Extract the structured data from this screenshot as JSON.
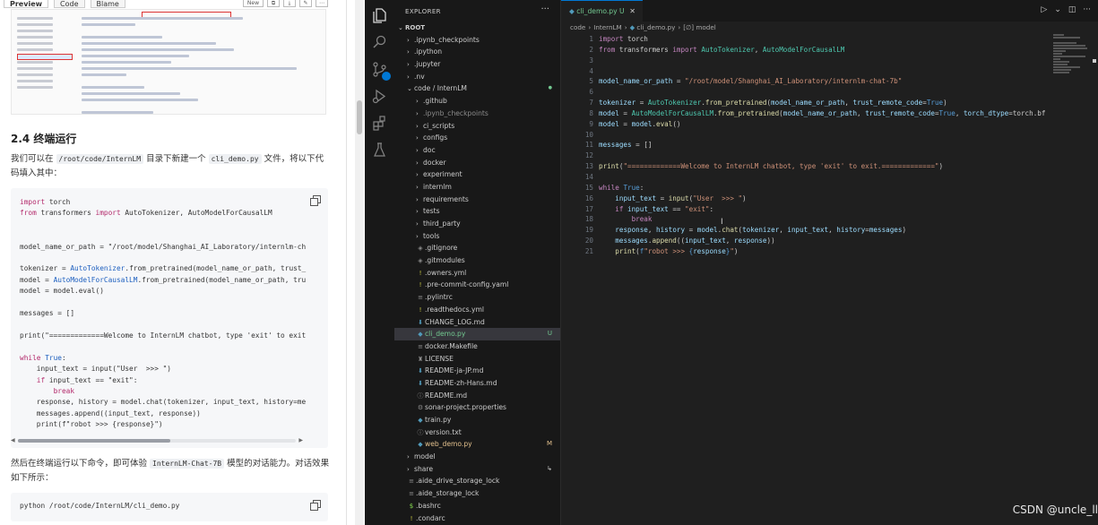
{
  "doc": {
    "tabs": [
      "Preview",
      "Code",
      "Blame"
    ],
    "tool_new": "New",
    "section_title": "2.4 终端运行",
    "para1": [
      "我们可以在 ",
      "/root/code/InternLM",
      " 目录下新建一个 ",
      "cli_demo.py",
      " 文件，将以下代码填入其中："
    ],
    "code_lines": [
      "import torch",
      "from transformers import AutoTokenizer, AutoModelForCausalLM",
      "",
      "",
      "model_name_or_path = \"/root/model/Shanghai_AI_Laboratory/internlm-ch",
      "",
      "tokenizer = AutoTokenizer.from_pretrained(model_name_or_path, trust_",
      "model = AutoModelForCausalLM.from_pretrained(model_name_or_path, tru",
      "model = model.eval()",
      "",
      "messages = []",
      "",
      "print(\"=============Welcome to InternLM chatbot, type 'exit' to exit",
      "",
      "while True:",
      "    input_text = input(\"User  >>> \")",
      "    if input_text == \"exit\":",
      "        break",
      "    response, history = model.chat(tokenizer, input_text, history=me",
      "    messages.append((input_text, response))",
      "    print(f\"robot >>> {response}\")"
    ],
    "para2": [
      "然后在终端运行以下命令，即可体验 ",
      "InternLM-Chat-7B",
      " 模型的对话能力。对话效果如下所示："
    ],
    "command": "python /root/code/InternLM/cli_demo.py"
  },
  "explorer": {
    "title": "EXPLORER",
    "more": "···",
    "items": [
      {
        "label": "ROOT",
        "depth": 0,
        "kind": "root-open"
      },
      {
        "label": ".ipynb_checkpoints",
        "depth": 1,
        "kind": "folder"
      },
      {
        "label": ".ipython",
        "depth": 1,
        "kind": "folder"
      },
      {
        "label": ".jupyter",
        "depth": 1,
        "kind": "folder"
      },
      {
        "label": ".nv",
        "depth": 1,
        "kind": "folder"
      },
      {
        "label": "code / InternLM",
        "depth": 1,
        "kind": "folder-open",
        "status": "dot"
      },
      {
        "label": ".github",
        "depth": 2,
        "kind": "folder"
      },
      {
        "label": ".ipynb_checkpoints",
        "depth": 2,
        "kind": "folder",
        "dim": true
      },
      {
        "label": "ci_scripts",
        "depth": 2,
        "kind": "folder"
      },
      {
        "label": "configs",
        "depth": 2,
        "kind": "folder"
      },
      {
        "label": "doc",
        "depth": 2,
        "kind": "folder"
      },
      {
        "label": "docker",
        "depth": 2,
        "kind": "folder"
      },
      {
        "label": "experiment",
        "depth": 2,
        "kind": "folder"
      },
      {
        "label": "internlm",
        "depth": 2,
        "kind": "folder"
      },
      {
        "label": "requirements",
        "depth": 2,
        "kind": "folder"
      },
      {
        "label": "tests",
        "depth": 2,
        "kind": "folder"
      },
      {
        "label": "third_party",
        "depth": 2,
        "kind": "folder"
      },
      {
        "label": "tools",
        "depth": 2,
        "kind": "folder"
      },
      {
        "label": ".gitignore",
        "depth": 2,
        "kind": "file",
        "icon": "◈"
      },
      {
        "label": ".gitmodules",
        "depth": 2,
        "kind": "file",
        "icon": "◈"
      },
      {
        "label": ".owners.yml",
        "depth": 2,
        "kind": "file",
        "icon": "!"
      },
      {
        "label": ".pre-commit-config.yaml",
        "depth": 2,
        "kind": "file",
        "icon": "!"
      },
      {
        "label": ".pylintrc",
        "depth": 2,
        "kind": "file",
        "icon": "≡"
      },
      {
        "label": ".readthedocs.yml",
        "depth": 2,
        "kind": "file",
        "icon": "!"
      },
      {
        "label": "CHANGE_LOG.md",
        "depth": 2,
        "kind": "file",
        "icon": "⬇"
      },
      {
        "label": "cli_demo.py",
        "depth": 2,
        "kind": "file",
        "icon": "◆",
        "status": "U",
        "selected": true
      },
      {
        "label": "docker.Makefile",
        "depth": 2,
        "kind": "file",
        "icon": "≡"
      },
      {
        "label": "LICENSE",
        "depth": 2,
        "kind": "file",
        "icon": "♜"
      },
      {
        "label": "README-ja-JP.md",
        "depth": 2,
        "kind": "file",
        "icon": "⬇"
      },
      {
        "label": "README-zh-Hans.md",
        "depth": 2,
        "kind": "file",
        "icon": "⬇"
      },
      {
        "label": "README.md",
        "depth": 2,
        "kind": "file",
        "icon": "ⓘ"
      },
      {
        "label": "sonar-project.properties",
        "depth": 2,
        "kind": "file",
        "icon": "⚙"
      },
      {
        "label": "train.py",
        "depth": 2,
        "kind": "file",
        "icon": "◆"
      },
      {
        "label": "version.txt",
        "depth": 2,
        "kind": "file",
        "icon": "ⓘ"
      },
      {
        "label": "web_demo.py",
        "depth": 2,
        "kind": "file",
        "icon": "◆",
        "status": "M"
      },
      {
        "label": "model",
        "depth": 1,
        "kind": "folder"
      },
      {
        "label": "share",
        "depth": 1,
        "kind": "folder",
        "status": "↳"
      },
      {
        "label": ".aide_drive_storage_lock",
        "depth": 1,
        "kind": "file",
        "icon": "≡"
      },
      {
        "label": ".aide_storage_lock",
        "depth": 1,
        "kind": "file",
        "icon": "≡"
      },
      {
        "label": ".bashrc",
        "depth": 1,
        "kind": "file",
        "icon": "$"
      },
      {
        "label": ".condarc",
        "depth": 1,
        "kind": "file",
        "icon": "!"
      }
    ]
  },
  "editor": {
    "tab_label": "cli_demo.py U",
    "tab_close": "✕",
    "breadcrumbs": [
      "code",
      "InternLM",
      "cli_demo.py",
      "[∅] model"
    ],
    "line_numbers": [
      "1",
      "2",
      "3",
      "4",
      "5",
      "6",
      "7",
      "8",
      "9",
      "10",
      "11",
      "12",
      "13",
      "14",
      "15",
      "16",
      "17",
      "18",
      "19",
      "20",
      "21"
    ]
  },
  "colors": {
    "accent": "#0078d4",
    "untracked": "#73c991",
    "modified": "#e2c08d",
    "keyword": "#c586c0",
    "string": "#ce9178"
  },
  "watermark": "CSDN @uncle_ll"
}
